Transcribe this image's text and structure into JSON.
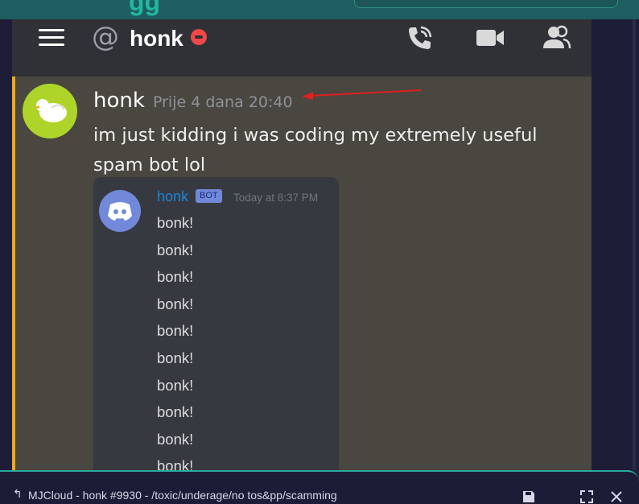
{
  "window": {
    "title": "MJCloud - honk #9930 - /toxic/underage/no tos&pp/scamming",
    "buttons": {
      "save": "save-icon",
      "fullscreen": "fullscreen-icon",
      "close": "close-icon"
    }
  },
  "header": {
    "channel_name": "honk",
    "icons": [
      "menu-icon",
      "at-icon",
      "dnd-status-icon",
      "phone-call-icon",
      "video-call-icon",
      "members-icon"
    ]
  },
  "message": {
    "username": "honk",
    "timestamp": "Prije 4 dana 20:40",
    "text": "im just kidding i was coding my extremely useful spam bot lol",
    "accent_color": "#f0a81e"
  },
  "embed": {
    "username": "honk",
    "badge": "BOT",
    "timestamp": "Today at 8:37 PM",
    "lines": [
      "bonk!",
      "bonk!",
      "bonk!",
      "bonk!",
      "bonk!",
      "bonk!",
      "bonk!",
      "bonk!",
      "bonk!",
      "bonk!"
    ]
  },
  "colors": {
    "discord_blurple": "#7289da",
    "annotation_arrow": "#e02020",
    "username_link": "#1a86d9"
  }
}
